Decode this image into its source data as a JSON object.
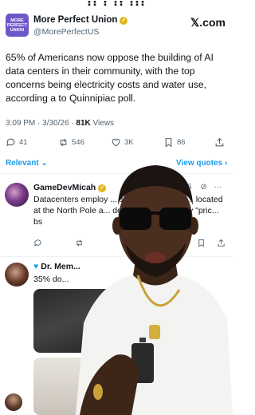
{
  "header": {
    "logo_text": "MORE PERFECT UNION",
    "account_name": "More Perfect Union",
    "handle": "@MorePerfectUS",
    "platform": "𝕏.com"
  },
  "tweet": {
    "text": "65% of Americans now oppose the building of AI data centers in their community, with the top concerns being electricity costs and water use, according a to Quinnipiac poll.",
    "time": "3:09 PM",
    "date": "3/30/26",
    "views_count": "81K",
    "views_label": "Views",
    "replies": "41",
    "reposts": "546",
    "likes": "3K",
    "bookmarks": "86"
  },
  "sort": {
    "relevant_label": "Relevant ⌄",
    "view_quotes_label": "View quotes ›"
  },
  "reply1": {
    "name": "GameDevMicah",
    "time": "6",
    "text": "Datacenters employ ... 100,000 sq feet, b... located at the North Pole a... de. No reason for any \"pric... bs"
  },
  "reply2": {
    "name": "Dr. Mem...",
    "text": "35% do..."
  },
  "colors": {
    "accent": "#1d9bf0",
    "logo": "#6e57c9",
    "verified": "#e2b719",
    "muted": "#536471"
  },
  "icons": [
    "reply-icon",
    "repost-icon",
    "like-icon",
    "bookmark-icon",
    "share-icon",
    "more-icon",
    "grok-icon",
    "verified-icon"
  ]
}
